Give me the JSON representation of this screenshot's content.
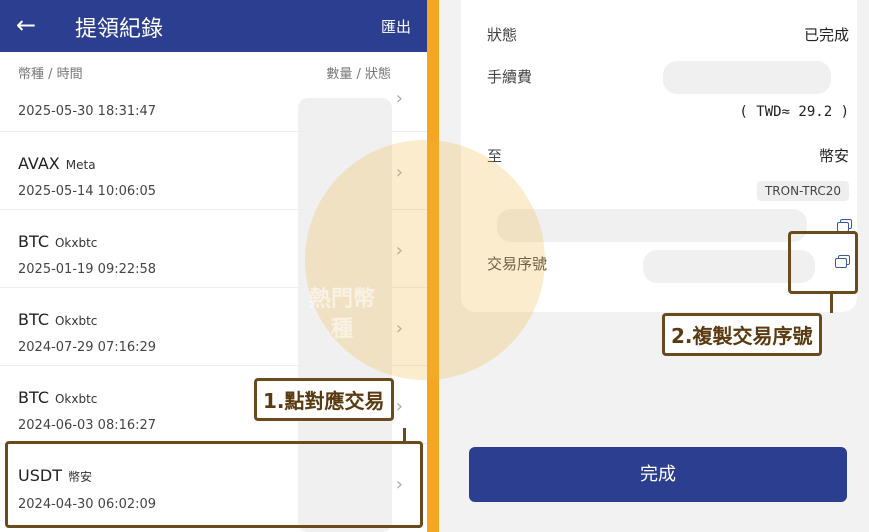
{
  "left": {
    "header": {
      "title": "提領紀錄",
      "back_icon": "←",
      "export_label": "匯出"
    },
    "column_heads": {
      "left": "幣種 / 時間",
      "right": "數量 / 狀態"
    },
    "first_row_time": "2025-05-30 18:31:47",
    "rows": [
      {
        "symbol": "AVAX",
        "exchange": "Meta",
        "time": "2025-05-14 10:06:05"
      },
      {
        "symbol": "BTC",
        "exchange": "Okxbtc",
        "time": "2025-01-19 09:22:58"
      },
      {
        "symbol": "BTC",
        "exchange": "Okxbtc",
        "time": "2024-07-29 07:16:29"
      },
      {
        "symbol": "BTC",
        "exchange": "Okxbtc",
        "time": "2024-06-03 08:16:27"
      },
      {
        "symbol": "USDT",
        "exchange": "幣安",
        "time": "2024-04-30 06:02:09"
      }
    ],
    "chevron": "›"
  },
  "right": {
    "status_label": "狀態",
    "status_value": "已完成",
    "fee_label": "手續費",
    "fee_twd": "( TWD≈ 29.2 )",
    "to_label": "至",
    "to_value": "幣安",
    "chain": "TRON-TRC20",
    "txid_label": "交易序號",
    "done_button": "完成"
  },
  "annotations": {
    "step1": "1.點對應交易",
    "step2": "2.複製交易序號"
  },
  "watermark": "熱門幣種",
  "colors": {
    "brand": "#2c3e8f",
    "accent": "#f5a623",
    "annotation": "#6b4a1e"
  }
}
